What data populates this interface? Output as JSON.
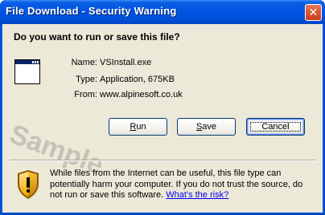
{
  "window": {
    "title": "File Download - Security Warning",
    "close_glyph": "✕"
  },
  "prompt": {
    "question": "Do you want to run or save this file?"
  },
  "file": {
    "icon": "application-window-icon",
    "name_label": "Name:",
    "name_value": "VSInstall.exe",
    "type_label": "Type:",
    "type_value": "Application, 675KB",
    "from_label": "From:",
    "from_value": "www.alpinesoft.co.uk"
  },
  "watermark": "Sample",
  "buttons": {
    "run_prefix": "",
    "run_mnemonic": "R",
    "run_rest": "un",
    "save_prefix": "",
    "save_mnemonic": "S",
    "save_rest": "ave",
    "cancel_label": "Cancel"
  },
  "warning": {
    "icon": "security-shield-warning-icon",
    "text": "While files from the Internet can be useful, this file type can potentially harm your computer. If you do not trust the source, do not run or save this software. ",
    "link": "What's the risk?"
  }
}
